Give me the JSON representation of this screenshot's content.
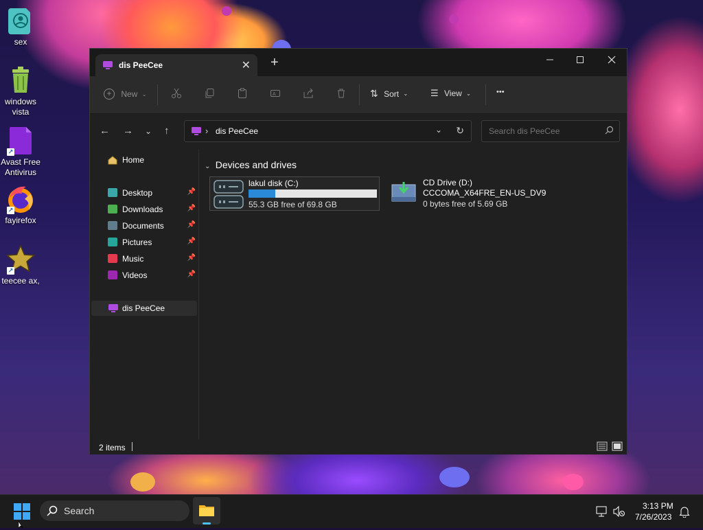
{
  "desktop": {
    "icons": [
      {
        "label": "sex",
        "icon": "user-folder-icon"
      },
      {
        "label": "windows vista",
        "icon": "recycle-bin-icon"
      },
      {
        "label": "Avast Free Antivirus",
        "icon": "avast-icon",
        "shortcut": true
      },
      {
        "label": "fayirefox",
        "icon": "firefox-icon",
        "shortcut": true
      },
      {
        "label": "teecee ax,",
        "icon": "star-icon",
        "shortcut": true
      }
    ]
  },
  "window": {
    "tab_title": "dis PeeCee",
    "new_tab_label": "+",
    "toolbar": {
      "new_label": "New",
      "sort_label": "Sort",
      "view_label": "View",
      "more_label": "•••"
    },
    "address": {
      "location": "dis PeeCee",
      "separator": "›"
    },
    "search": {
      "placeholder": "Search dis PeeCee"
    },
    "sidebar": {
      "home": "Home",
      "pinned": [
        {
          "label": "Desktop",
          "color": "#3aa7a8"
        },
        {
          "label": "Downloads",
          "color": "#4caf50"
        },
        {
          "label": "Documents",
          "color": "#607d8b"
        },
        {
          "label": "Pictures",
          "color": "#26a69a"
        },
        {
          "label": "Music",
          "color": "#e53950"
        },
        {
          "label": "Videos",
          "color": "#9c27b0"
        }
      ],
      "this_pc": "dis PeeCee"
    },
    "content": {
      "group_title": "Devices and drives",
      "drives": [
        {
          "name": "lakul disk (C:)",
          "free": "55.3 GB free of 69.8 GB",
          "used_fraction": 0.21
        },
        {
          "name": "CD Drive (D:)",
          "volume": "CCCOMA_X64FRE_EN-US_DV9",
          "free": "0 bytes free of 5.69 GB"
        }
      ]
    },
    "status": {
      "items": "2 items"
    }
  },
  "taskbar": {
    "search_label": "Search",
    "time": "3:13 PM",
    "date": "7/26/2023"
  },
  "colors": {
    "accent": "#2b8ad8",
    "pc_icon": "#b04be0"
  }
}
